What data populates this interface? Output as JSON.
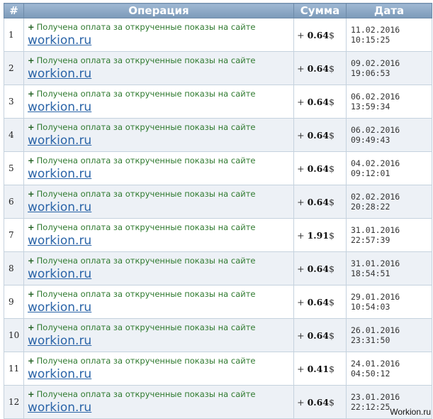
{
  "table": {
    "headers": {
      "num": "#",
      "operation": "Операция",
      "amount": "Сумма",
      "date": "Дата"
    },
    "rows": [
      {
        "num": "1",
        "prefix": "+",
        "text": "Получена оплата за открученные показы на сайте",
        "link": "workion.ru",
        "sign": "+",
        "amount": "0.64",
        "currency": "$",
        "date": "11.02.2016",
        "time": "10:15:25"
      },
      {
        "num": "2",
        "prefix": "+",
        "text": "Получена оплата за открученные показы на сайте",
        "link": "workion.ru",
        "sign": "+",
        "amount": "0.64",
        "currency": "$",
        "date": "09.02.2016",
        "time": "19:06:53"
      },
      {
        "num": "3",
        "prefix": "+",
        "text": "Получена оплата за открученные показы на сайте",
        "link": "workion.ru",
        "sign": "+",
        "amount": "0.64",
        "currency": "$",
        "date": "06.02.2016",
        "time": "13:59:34"
      },
      {
        "num": "4",
        "prefix": "+",
        "text": "Получена оплата за открученные показы на сайте",
        "link": "workion.ru",
        "sign": "+",
        "amount": "0.64",
        "currency": "$",
        "date": "06.02.2016",
        "time": "09:49:43"
      },
      {
        "num": "5",
        "prefix": "+",
        "text": "Получена оплата за открученные показы на сайте",
        "link": "workion.ru",
        "sign": "+",
        "amount": "0.64",
        "currency": "$",
        "date": "04.02.2016",
        "time": "09:12:01"
      },
      {
        "num": "6",
        "prefix": "+",
        "text": "Получена оплата за открученные показы на сайте",
        "link": "workion.ru",
        "sign": "+",
        "amount": "0.64",
        "currency": "$",
        "date": "02.02.2016",
        "time": "20:28:22"
      },
      {
        "num": "7",
        "prefix": "+",
        "text": "Получена оплата за открученные показы на сайте",
        "link": "workion.ru",
        "sign": "+",
        "amount": "1.91",
        "currency": "$",
        "date": "31.01.2016",
        "time": "22:57:39"
      },
      {
        "num": "8",
        "prefix": "+",
        "text": "Получена оплата за открученные показы на сайте",
        "link": "workion.ru",
        "sign": "+",
        "amount": "0.64",
        "currency": "$",
        "date": "31.01.2016",
        "time": "18:54:51"
      },
      {
        "num": "9",
        "prefix": "+",
        "text": "Получена оплата за открученные показы на сайте",
        "link": "workion.ru",
        "sign": "+",
        "amount": "0.64",
        "currency": "$",
        "date": "29.01.2016",
        "time": "10:54:03"
      },
      {
        "num": "10",
        "prefix": "+",
        "text": "Получена оплата за открученные показы на сайте",
        "link": "workion.ru",
        "sign": "+",
        "amount": "0.64",
        "currency": "$",
        "date": "26.01.2016",
        "time": "23:31:50"
      },
      {
        "num": "11",
        "prefix": "+",
        "text": "Получена оплата за открученные показы на сайте",
        "link": "workion.ru",
        "sign": "+",
        "amount": "0.41",
        "currency": "$",
        "date": "24.01.2016",
        "time": "04:50:12"
      },
      {
        "num": "12",
        "prefix": "+",
        "text": "Получена оплата за открученные показы на сайте",
        "link": "workion.ru",
        "sign": "+",
        "amount": "0.64",
        "currency": "$",
        "date": "23.01.2016",
        "time": "22:12:25"
      }
    ]
  },
  "watermark": "Workion.ru",
  "colors": {
    "header_bg": "#8aa6c4",
    "row_alt_bg": "#edf1f6",
    "link": "#2a64a8",
    "operation_text": "#2f7a2f"
  }
}
